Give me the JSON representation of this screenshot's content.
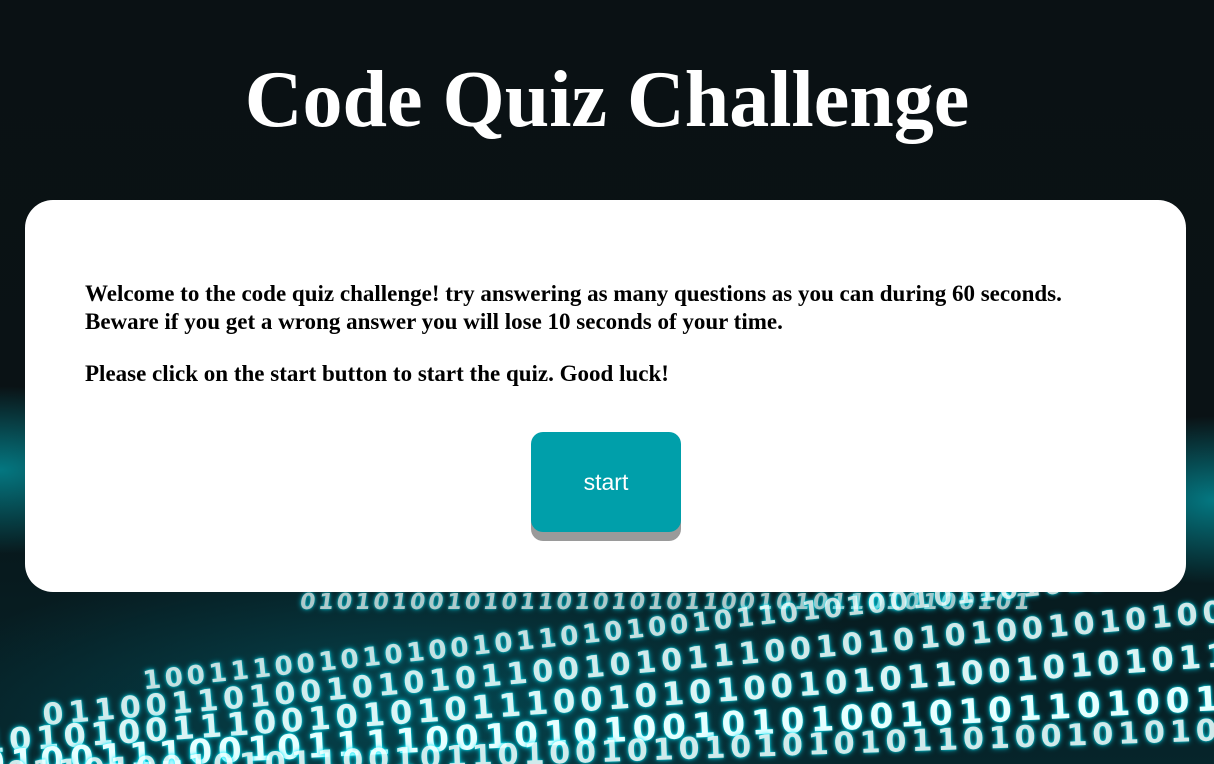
{
  "header": {
    "title": "Code Quiz Challenge"
  },
  "card": {
    "intro_line1": "Welcome to the code quiz challenge! try answering as many questions as you can during 60 seconds.",
    "intro_line2": "Beware if you get a wrong answer you will lose 10 seconds of your time.",
    "instruction": "Please click on the start button to start the quiz. Good luck!",
    "start_label": "start"
  },
  "colors": {
    "background": "#0a1114",
    "card": "#ffffff",
    "button": "#009faa",
    "button_shadow": "#9a9a9a",
    "binary_glow": "#00e6ff"
  }
}
